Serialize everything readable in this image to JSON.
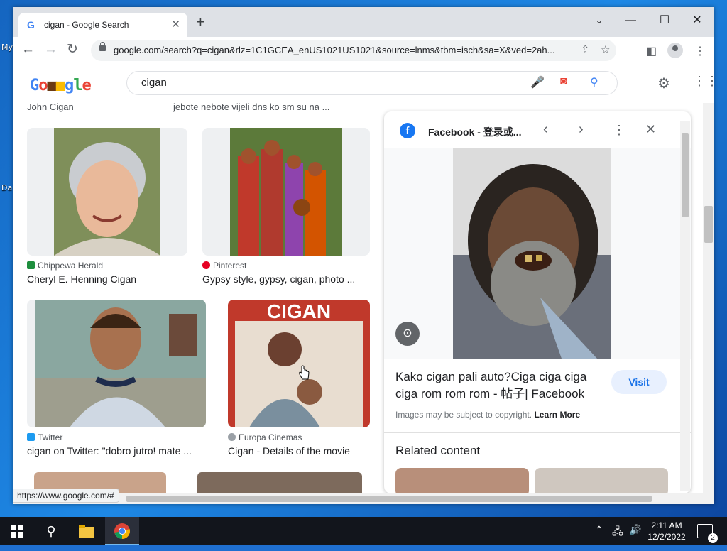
{
  "desktop": {
    "labels": [
      "My",
      "Da"
    ]
  },
  "browser": {
    "tab_title": "cigan - Google Search",
    "url": "google.com/search?q=cigan&rlz=1C1GCEA_enUS1021US1021&source=lnms&tbm=isch&sa=X&ved=2ah...",
    "status_url": "https://www.google.com/#"
  },
  "search": {
    "query": "cigan",
    "logo": "Google"
  },
  "results": {
    "cut_titles": [
      "John Cigan",
      "jebote nebote vijeli dns ko sm su na ..."
    ],
    "items": [
      {
        "source": "Chippewa Herald",
        "title": "Cheryl E. Henning Cigan"
      },
      {
        "source": "Pinterest",
        "title": "Gypsy style, gypsy, cigan, photo ..."
      },
      {
        "source": "Twitter",
        "title": "cigan on Twitter: \"dobro jutro! mate ..."
      },
      {
        "source": "Europa Cinemas",
        "title": "Cigan - Details of the movie",
        "poster_text": "CIGAN"
      }
    ]
  },
  "panel": {
    "source": "Facebook - 登录或...",
    "title": "Kako cigan pali auto?Ciga ciga ciga ciga rom rom rom - 帖子| Facebook",
    "visit": "Visit",
    "copyright": "Images may be subject to copyright.",
    "learn_more": "Learn More",
    "related": "Related content"
  },
  "taskbar": {
    "time": "2:11 AM",
    "date": "12/2/2022",
    "notifications": "2"
  },
  "colors": {
    "google_blue": "#4285f4",
    "facebook": "#1877f2",
    "link": "#1a73e8"
  }
}
